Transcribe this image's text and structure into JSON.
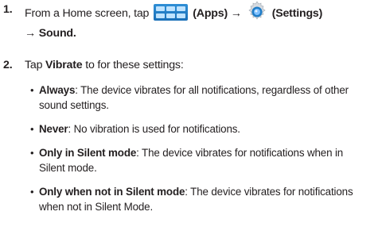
{
  "steps": [
    {
      "number": "1.",
      "line1": {
        "prefix": "From a Home screen, tap",
        "apps_label": "(Apps) →",
        "settings_label": "(Settings)"
      },
      "line2": {
        "arrow": "→",
        "sound": "Sound",
        "period": "."
      }
    },
    {
      "number": "2.",
      "text": {
        "prefix": "Tap ",
        "vibrate": "Vibrate",
        "suffix": " to for these settings:"
      }
    }
  ],
  "bullets": [
    {
      "term": "Always",
      "line1_rest": ": The device vibrates for all notifications, regardless of other",
      "line2": "sound settings."
    },
    {
      "term": "Never",
      "line1_rest": ": No vibration is used for notifications."
    },
    {
      "term": "Only in Silent mode",
      "line1_rest": ": The device vibrates for notifications when in",
      "line2": "Silent mode."
    },
    {
      "term": "Only when not in Silent mode",
      "line1_rest": ": The device vibrates for notifications",
      "line2": "when not in Silent Mode."
    }
  ],
  "icons": {
    "apps": "apps-grid-icon",
    "settings": "gear-icon",
    "apps_color": "#1f7cc6",
    "settings_color": "#1f7cc6"
  }
}
